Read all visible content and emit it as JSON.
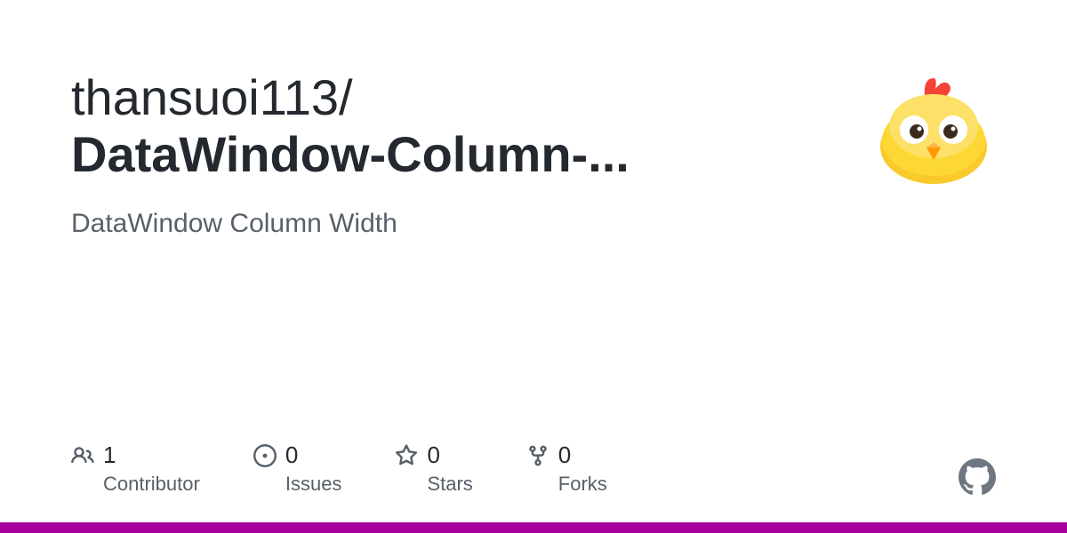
{
  "repo": {
    "owner": "thansuoi113",
    "slash": "/",
    "name": "DataWindow-Column-...",
    "description": "DataWindow Column Width"
  },
  "stats": {
    "contributors": {
      "count": "1",
      "label": "Contributor"
    },
    "issues": {
      "count": "0",
      "label": "Issues"
    },
    "stars": {
      "count": "0",
      "label": "Stars"
    },
    "forks": {
      "count": "0",
      "label": "Forks"
    }
  },
  "accentColor": "#a6009c"
}
